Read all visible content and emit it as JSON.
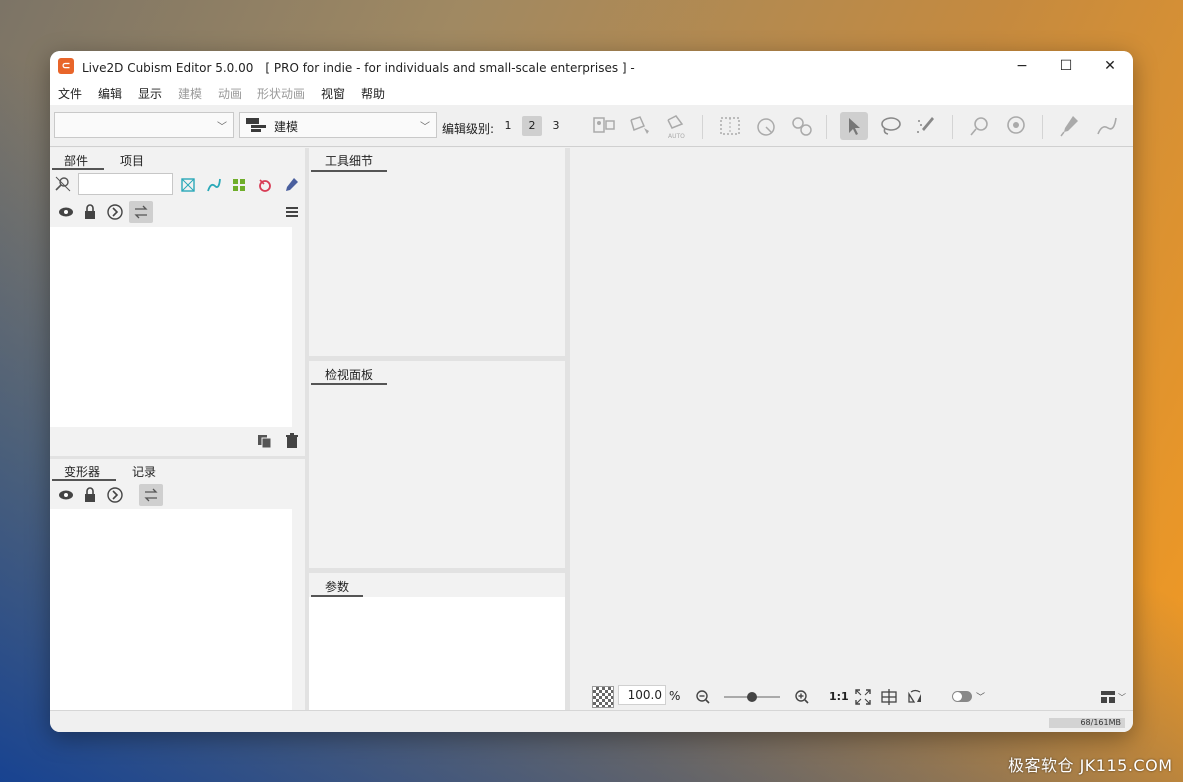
{
  "window": {
    "title": "Live2D Cubism Editor 5.0.00　[ PRO for indie - for individuals and small-scale enterprises ]  -",
    "logo_glyph": "⊂",
    "minimize": "−",
    "maximize": "☐",
    "close": "✕"
  },
  "menu": {
    "items": [
      {
        "label": "文件",
        "enabled": true
      },
      {
        "label": "编辑",
        "enabled": true
      },
      {
        "label": "显示",
        "enabled": true
      },
      {
        "label": "建模",
        "enabled": false
      },
      {
        "label": "动画",
        "enabled": false
      },
      {
        "label": "形状动画",
        "enabled": false
      },
      {
        "label": "视窗",
        "enabled": true
      },
      {
        "label": "帮助",
        "enabled": true
      }
    ]
  },
  "toolbar": {
    "document_select": "",
    "mode_select": "建模",
    "edit_level_label": "编辑级别:",
    "edit_levels": [
      "1",
      "2",
      "3"
    ],
    "active_level": "2",
    "auto_label": "AUTO"
  },
  "parts_panel": {
    "tabs": [
      "部件",
      "项目"
    ]
  },
  "deformer_panel": {
    "tabs": [
      "变形器",
      "记录"
    ]
  },
  "tool_detail_panel": {
    "title": "工具细节"
  },
  "inspector_panel": {
    "title": "检视面板"
  },
  "parameter_panel": {
    "title": "参数"
  },
  "canvas": {
    "zoom_value": "100.0",
    "zoom_unit": "%",
    "zoom_slider": 0.5,
    "actual_size_label": "1:1"
  },
  "status": {
    "memory": "68/161MB"
  },
  "watermark": "极客软仓 JK115.COM",
  "colors": {
    "accent_logo": "#e8652a",
    "icon_teal": "#2aa9b8",
    "icon_green": "#6fae2a",
    "icon_red": "#d83b55",
    "icon_blue": "#4a5f9e"
  }
}
